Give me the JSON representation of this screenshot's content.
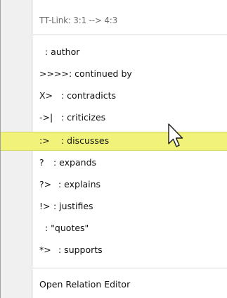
{
  "menu": {
    "header": "TT-Link: 3:1 --> 4:3",
    "items": [
      {
        "symbol": "",
        "label": ": author"
      },
      {
        "symbol": ">>>>",
        "label": ": continued by"
      },
      {
        "symbol": "X>",
        "label": ": contradicts"
      },
      {
        "symbol": "->|",
        "label": ": criticizes"
      },
      {
        "symbol": ":>",
        "label": ": discusses"
      },
      {
        "symbol": "?",
        "label": ": expands"
      },
      {
        "symbol": "?>",
        "label": ": explains"
      },
      {
        "symbol": "!>",
        "label": ": justifies"
      },
      {
        "symbol": "",
        "label": ": \"quotes\""
      },
      {
        "symbol": "*>",
        "label": ": supports"
      }
    ],
    "footer": "Open Relation Editor"
  },
  "colors": {
    "highlight": "#f0f27a",
    "gutter": "#f0f0f0"
  },
  "cursor": "arrow-cursor-icon"
}
